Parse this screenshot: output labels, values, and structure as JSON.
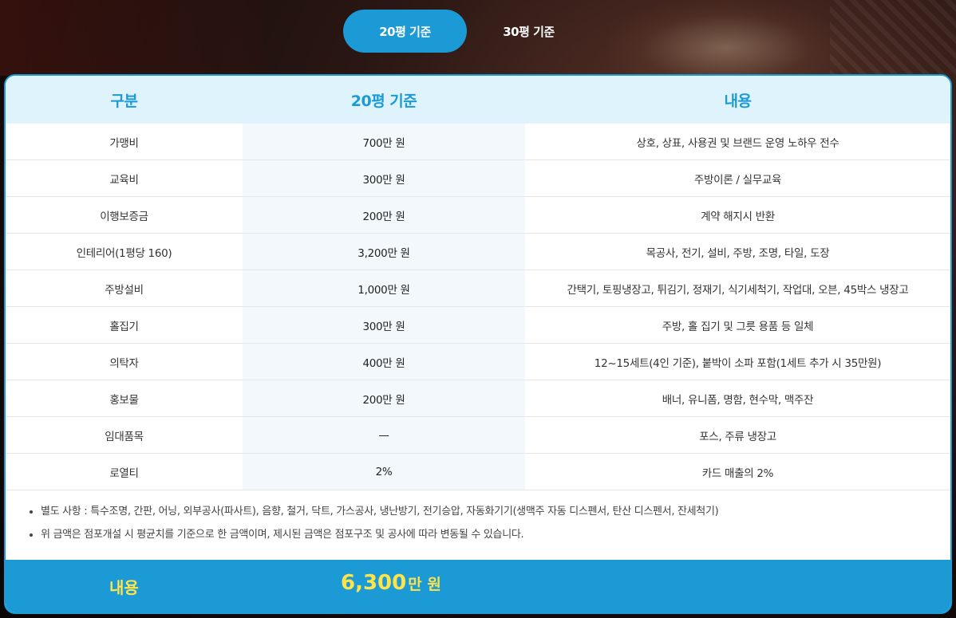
{
  "tabs": [
    {
      "label": "20평 기준",
      "active": true
    },
    {
      "label": "30평 기준",
      "active": false
    }
  ],
  "table": {
    "headers": [
      "구분",
      "20평 기준",
      "내용"
    ],
    "rows": [
      {
        "item": "가맹비",
        "cost": "700만 원",
        "desc": "상호, 상표, 사용권 및 브랜드 운영 노하우 전수"
      },
      {
        "item": "교육비",
        "cost": "300만 원",
        "desc": "주방이론 / 실무교육"
      },
      {
        "item": "이행보증금",
        "cost": "200만 원",
        "desc": "계약 해지시 반환"
      },
      {
        "item": "인테리어(1평당 160)",
        "cost": "3,200만 원",
        "desc": "목공사, 전기, 설비, 주방, 조명, 타일, 도장"
      },
      {
        "item": "주방설비",
        "cost": "1,000만 원",
        "desc": "간택기, 토핑냉장고, 튀김기, 정재기, 식기세척기, 작업대, 오븐, 45박스 냉장고"
      },
      {
        "item": "홀집기",
        "cost": "300만 원",
        "desc": "주방, 홀 집기 및 그릇 용품 등 일체"
      },
      {
        "item": "의탁자",
        "cost": "400만 원",
        "desc": "12~15세트(4인 기준), 붙박이 소파 포함(1세트 추가 시 35만원)"
      },
      {
        "item": "홍보물",
        "cost": "200만 원",
        "desc": "배너, 유니폼, 명함, 현수막, 맥주잔"
      },
      {
        "item": "임대품목",
        "cost": "—",
        "desc": "포스, 주류 냉장고"
      },
      {
        "item": "로열티",
        "cost": "2%",
        "desc": "카드 매출의 2%"
      }
    ]
  },
  "notes": [
    "별도 사항 : 특수조명, 간판, 어닝, 외부공사(파사트), 음향, 철거, 닥트, 가스공사, 냉난방기, 전기승압, 자동화기기(생맥주 자동 디스펜서, 탄산 디스펜서, 잔세척기)",
    "위 금액은 점포개설 시 평균치를 기준으로 한 금액이며, 제시된 금액은 점포구조 및 공사에 따라 변동될 수 있습니다."
  ],
  "total": {
    "label": "내용",
    "amount": "6,300",
    "unit": "만 원"
  },
  "colors": {
    "accent": "#1b9ad6",
    "header_bg": "#dff3fd",
    "total_text": "#ffe34a"
  }
}
